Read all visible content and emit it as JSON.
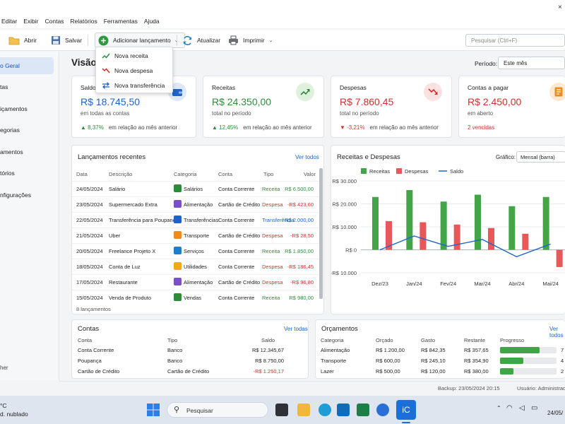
{
  "menu": [
    "Editar",
    "Exibir",
    "Contas",
    "Relatórios",
    "Ferramentas",
    "Ajuda"
  ],
  "toolbar": {
    "open_label": "Abrir",
    "save_label": "Salvar",
    "add_label": "Adicionar lançamento",
    "refresh_label": "Atualizar",
    "print_label": "Imprimir",
    "search_placeholder": "Pesquisar (Ctrl+F)"
  },
  "add_menu": {
    "income": "Nova receita",
    "expense": "Nova despesa",
    "transfer": "Nova transferência"
  },
  "sidebar": {
    "items": [
      "o Geral",
      "tas",
      "içamentos",
      "egorias",
      "amentos",
      "tórios",
      "nfigurações"
    ],
    "footer": "her"
  },
  "main": {
    "title": "Visão G",
    "period_label": "Período:",
    "period_value": "Este mês"
  },
  "kpis": [
    {
      "title": "Saldo t",
      "value": "R$ 18.745,50",
      "sub": "em todas as contas",
      "trend": "8,37%",
      "trend_text": "em relação ao mês anterior",
      "value_color": "#1d63c9"
    },
    {
      "title": "Receitas",
      "value": "R$ 24.350,00",
      "sub": "total no período",
      "trend": "12,45%",
      "trend_text": "em relação ao mês anterior",
      "value_color": "#2e8b3a"
    },
    {
      "title": "Despesas",
      "value": "R$ 7.860,45",
      "sub": "total no período",
      "trend": "-3,21%",
      "trend_text": "em relação ao mês anterior",
      "value_color": "#d32f2f"
    },
    {
      "title": "Contas a pagar",
      "value": "R$ 2.450,00",
      "sub": "em aberto",
      "trend": "2 vencidas",
      "trend_text": "",
      "value_color": "#d32f2f"
    }
  ],
  "transactions": {
    "title": "Lançamentos recentes",
    "link": "Ver todos",
    "headers": [
      "Data",
      "Descrição",
      "Categoria",
      "Conta",
      "Tipo",
      "Valor"
    ],
    "rows": [
      {
        "date": "24/05/2024",
        "desc": "Salário",
        "cat": "Salários",
        "account": "Conta Corrente",
        "type": "Receita",
        "value": "R$ 6.500,00",
        "kind": "in",
        "icon": "wallet-icon"
      },
      {
        "date": "23/05/2024",
        "desc": "Supermercado Extra",
        "cat": "Alimentação",
        "account": "Cartão de Crédito",
        "type": "Despesa",
        "value": "-R$ 423,60",
        "kind": "out",
        "icon": "cart-icon"
      },
      {
        "date": "22/05/2024",
        "desc": "Transferência para Poupança",
        "cat": "Transferências",
        "account": "Conta Corrente",
        "type": "Transferência",
        "value": "-R$ 2.000,00",
        "kind": "transfer",
        "icon": "transfer-icon"
      },
      {
        "date": "21/05/2024",
        "desc": "Uber",
        "cat": "Transporte",
        "account": "Cartão de Crédito",
        "type": "Despesa",
        "value": "-R$ 28,50",
        "kind": "out",
        "icon": "car-icon"
      },
      {
        "date": "20/05/2024",
        "desc": "Freelance Projeto X",
        "cat": "Serviços",
        "account": "Conta Corrente",
        "type": "Receita",
        "value": "R$ 1.850,00",
        "kind": "in",
        "icon": "person-icon"
      },
      {
        "date": "18/05/2024",
        "desc": "Conta de Luz",
        "cat": "Utilidades",
        "account": "Conta Corrente",
        "type": "Despesa",
        "value": "-R$ 186,45",
        "kind": "out",
        "icon": "bulb-icon"
      },
      {
        "date": "17/05/2024",
        "desc": "Restaurante",
        "cat": "Alimentação",
        "account": "Cartão de Crédito",
        "type": "Despesa",
        "value": "-R$ 96,80",
        "kind": "out",
        "icon": "cart-icon"
      },
      {
        "date": "15/05/2024",
        "desc": "Venda de Produto",
        "cat": "Vendas",
        "account": "Conta Corrente",
        "type": "Receita",
        "value": "R$ 980,00",
        "kind": "in",
        "icon": "tag-icon"
      }
    ],
    "count": "8 lançamentos"
  },
  "chart_panel": {
    "title": "Receitas e Despesas",
    "type_label": "Gráfico:",
    "type_value": "Mensal (barra)"
  },
  "chart_data": {
    "type": "bar",
    "categories": [
      "Dez/23",
      "Jan/24",
      "Fev/24",
      "Mar/24",
      "Abr/24",
      "Mai/24"
    ],
    "series": [
      {
        "name": "Receitas",
        "type": "bar",
        "color": "#43a548",
        "values": [
          23000,
          26000,
          21000,
          24000,
          19000,
          23000
        ]
      },
      {
        "name": "Despesas",
        "type": "bar",
        "color": "#e8585a",
        "values": [
          12500,
          12000,
          11000,
          9500,
          7000,
          -7500
        ]
      },
      {
        "name": "Saldo",
        "type": "line",
        "color": "#1d63c9",
        "values": [
          0,
          6000,
          1500,
          4500,
          -3000,
          2500
        ]
      }
    ],
    "yticks": [
      "R$ 30.000",
      "R$ 20.000",
      "R$ 10.000",
      "R$ 0",
      "-R$ 10.000"
    ],
    "ylim": [
      -10000,
      30000
    ],
    "legend": "top",
    "grid": true
  },
  "accounts": {
    "title": "Contas",
    "link": "Ver todas",
    "headers": [
      "Conta",
      "Tipo",
      "Saldo"
    ],
    "rows": [
      {
        "name": "Conta Corrente",
        "type": "Banco",
        "balance": "R$ 12.345,67",
        "neg": false
      },
      {
        "name": "Poupança",
        "type": "Banco",
        "balance": "R$ 8.750,00",
        "neg": false
      },
      {
        "name": "Cartão de Crédito",
        "type": "Cartão de Crédito",
        "balance": "-R$ 1.250,17",
        "neg": true
      }
    ]
  },
  "budgets": {
    "title": "Orçamentos",
    "link": "Ver todos",
    "headers": [
      "Categoria",
      "Orçado",
      "Gasto",
      "Restante",
      "Progresso"
    ],
    "rows": [
      {
        "cat": "Alimentação",
        "budget": "R$ 1.200,00",
        "spent": "R$ 842,35",
        "rest": "R$ 357,65",
        "progress": 0.7,
        "pct": "7"
      },
      {
        "cat": "Transporte",
        "budget": "R$ 600,00",
        "spent": "R$ 245,10",
        "rest": "R$ 354,90",
        "progress": 0.41,
        "pct": "4"
      },
      {
        "cat": "Lazer",
        "budget": "R$ 500,00",
        "spent": "R$ 120,00",
        "rest": "R$ 380,00",
        "progress": 0.24,
        "pct": "2"
      }
    ]
  },
  "status": {
    "backup": "Backup: 23/05/2024 20:15",
    "user": "Usuário: Administrado"
  },
  "taskbar": {
    "weather_temp": "°C",
    "weather_text": "d. nublado",
    "search": "Pesquisar",
    "time": "24/05/"
  }
}
